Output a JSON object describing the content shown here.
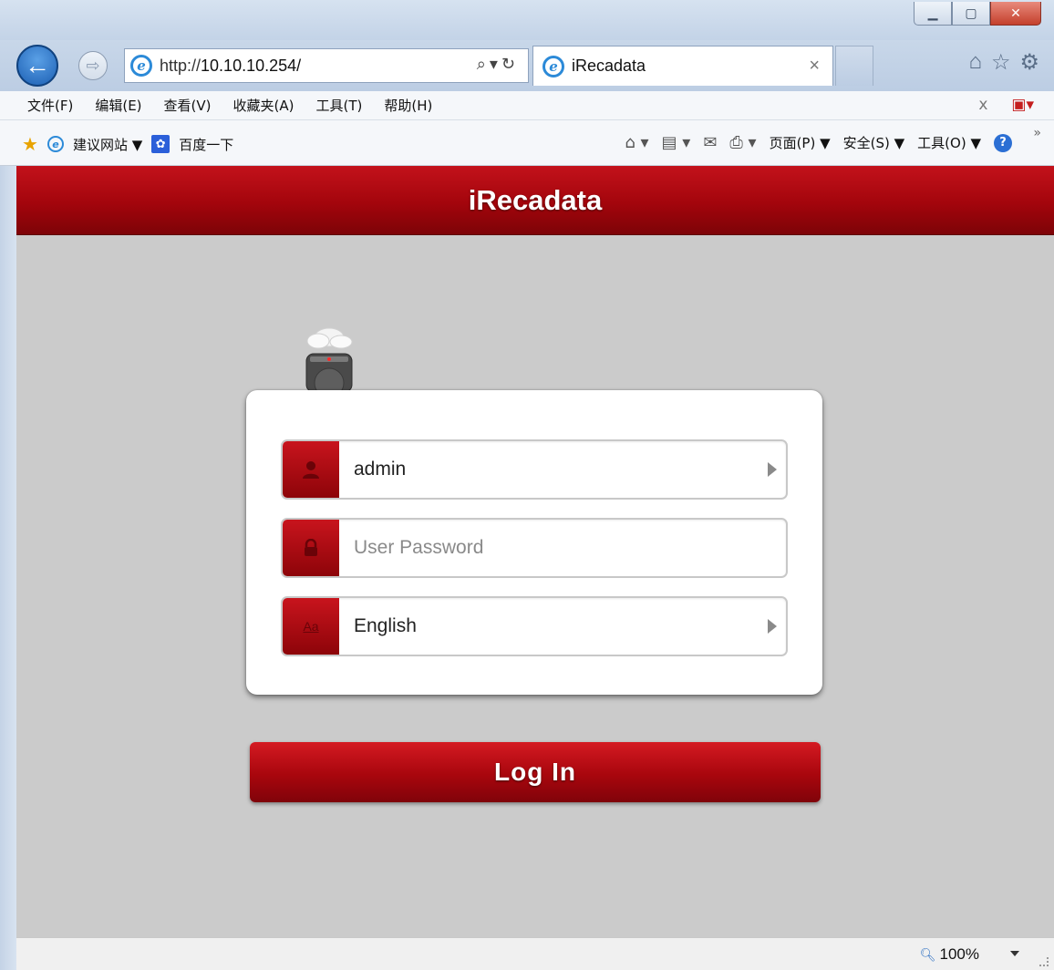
{
  "browser": {
    "url_prefix": "http://",
    "url_host": "10.10.10.254/",
    "tab_title": "iRecadata",
    "menu": [
      "文件(F)",
      "编辑(E)",
      "查看(V)",
      "收藏夹(A)",
      "工具(T)",
      "帮助(H)"
    ],
    "favorites": [
      "建议网站 ▼",
      "百度一下"
    ],
    "command_bar": [
      "页面(P) ▼",
      "安全(S) ▼",
      "工具(O) ▼"
    ],
    "zoom": "100%"
  },
  "page": {
    "title": "iRecadata"
  },
  "login": {
    "username_value": "admin",
    "password_placeholder": "User Password",
    "language_value": "English",
    "login_button_label": "Log In"
  },
  "colors": {
    "brand_red": "#b00a12",
    "page_bg": "#cbcbcb"
  },
  "icons": [
    "back-arrow-icon",
    "forward-arrow-icon",
    "ie-logo-icon",
    "search-icon",
    "refresh-icon",
    "home-icon",
    "star-icon",
    "gear-icon",
    "user-icon",
    "lock-icon",
    "language-icon",
    "dropdown-arrow-icon",
    "zoom-icon"
  ]
}
